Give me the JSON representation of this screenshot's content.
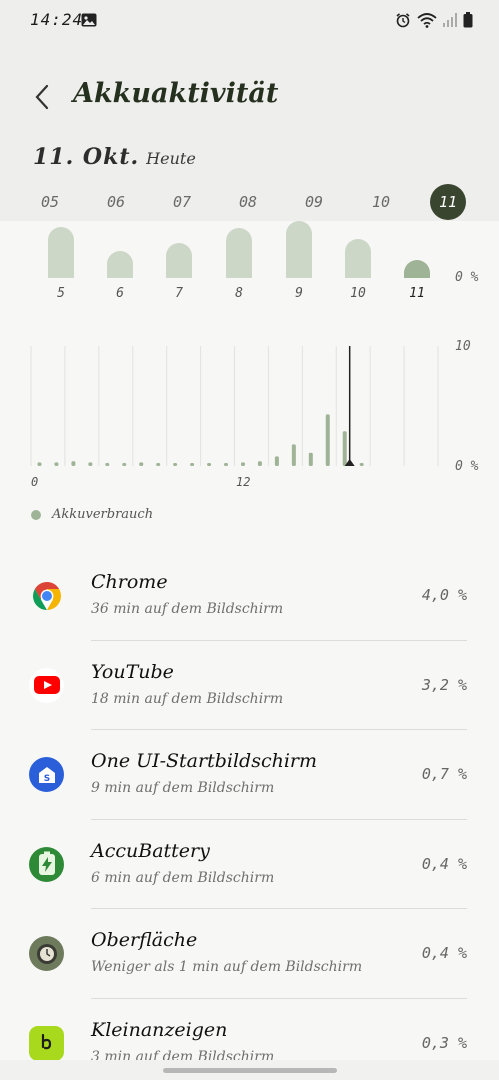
{
  "status_bar": {
    "time": "14:24",
    "icons": [
      "gallery-icon",
      "alarm-icon",
      "wifi-icon",
      "signal-icon",
      "battery-icon"
    ]
  },
  "header": {
    "title": "Akkuaktivität",
    "date": "11. Okt.",
    "date_sub": "Heute"
  },
  "day_tabs": [
    "05",
    "06",
    "07",
    "08",
    "09",
    "10",
    "11"
  ],
  "active_day": "11",
  "week_chart": {
    "labels": [
      "5",
      "6",
      "7",
      "8",
      "9",
      "10",
      "11"
    ],
    "values": [
      54,
      28,
      37,
      53,
      60,
      41,
      19
    ],
    "y_label": "0 %"
  },
  "chart_data": {
    "type": "bar",
    "x": [
      0,
      1,
      2,
      3,
      4,
      5,
      6,
      7,
      8,
      9,
      10,
      11,
      12,
      13,
      14,
      15,
      16,
      17,
      18,
      19,
      20,
      21,
      22,
      23
    ],
    "values": [
      0.3,
      0.3,
      0.4,
      0.3,
      0.2,
      0.2,
      0.3,
      0.2,
      0.2,
      0.2,
      0.2,
      0.2,
      0.3,
      0.4,
      0.8,
      1.8,
      1.1,
      4.3,
      2.9,
      0.2,
      0,
      0,
      0,
      0
    ],
    "ylim": [
      0,
      10
    ],
    "y_ticks": [
      "10",
      "0 %"
    ],
    "x_ticks": [
      "0",
      "12"
    ],
    "legend": "Akkuverbrauch",
    "color": "#9fb396"
  },
  "apps": [
    {
      "name": "Chrome",
      "usage": "36 min auf dem Bildschirm",
      "percent": "4,0 %",
      "icon": "chrome-icon"
    },
    {
      "name": "YouTube",
      "usage": "18 min auf dem Bildschirm",
      "percent": "3,2 %",
      "icon": "youtube-icon"
    },
    {
      "name": "One UI-Startbildschirm",
      "usage": "9 min auf dem Bildschirm",
      "percent": "0,7 %",
      "icon": "one-ui-home-icon"
    },
    {
      "name": "AccuBattery",
      "usage": "6 min auf dem Bildschirm",
      "percent": "0,4 %",
      "icon": "accubattery-icon"
    },
    {
      "name": "Oberfläche",
      "usage": "Weniger als 1 min auf dem Bildschirm",
      "percent": "0,4 %",
      "icon": "oberflaeche-icon"
    },
    {
      "name": "Kleinanzeigen",
      "usage": "3 min auf dem Bildschirm",
      "percent": "0,3 %",
      "icon": "kleinanzeigen-icon"
    }
  ],
  "colors": {
    "accent_dark": "#3a4530",
    "bar_light": "#ccd7c7",
    "bar_current": "#9fb396",
    "header_bg": "#eeeeec"
  }
}
